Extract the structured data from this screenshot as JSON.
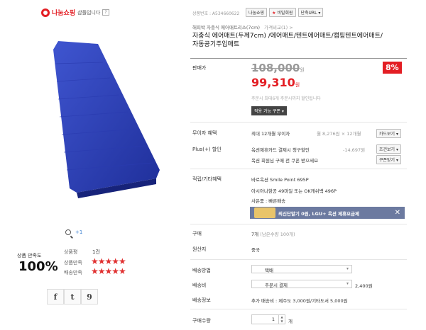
{
  "store": {
    "name": "나눔쇼핑",
    "suffix": "샵플입니다",
    "help_glyph": "?"
  },
  "header": {
    "product_no": "상품번호 : A534660622",
    "seller_badge": "나눔쇼핑",
    "mini_shop": "비밀회원",
    "shortcut": "단축URL"
  },
  "title": {
    "category": "해피박 자충식 에어매트리스(7cm)",
    "compare": "가격비교(1) >",
    "line1": "자충식 에어매트(두께7cm) /에어매트/텐트에어매트/캠핑텐트에어매트/",
    "line2": "자동공기주입매트"
  },
  "price": {
    "label": "판매가",
    "original": "108,000",
    "original_unit": "원",
    "discount_badge": "8%",
    "sale": "99,310",
    "sale_unit": "원",
    "note": "주문시 최대6개 주문시까지 할인됩니다",
    "coupon_button": "적용 가능 쿠폰"
  },
  "benefits": {
    "installment_label": "무이자 혜택",
    "installment_text": "최대 12개월 무이자",
    "installment_detail": "월 8,276원 × 12개월",
    "installment_btn": "카드보기",
    "plus_label": "Plus(+) 할인",
    "plus_text": "옥션제휴카드 결제시 청구할인",
    "plus_amount": "-14,697원",
    "plus_btn": "조건보기",
    "coupon_text": "옥션 회원님 구매 전 쿠폰 받으세요",
    "coupon_btn": "쿠폰받기"
  },
  "points": {
    "label": "적립/기타혜택",
    "line1": "바로옥션 Smile Point 695P",
    "line2": "아시아나항공 49마일 또는 OK캐쉬백 496P",
    "line3": "사은품 : 빠른배송",
    "banner": "최신단말기 0원, LGU+ 옥션 제휴요금제"
  },
  "purchase": {
    "qty_label": "구매",
    "qty_text": "7개",
    "qty_remain": "(남은수량 100개)",
    "origin_label": "원산지",
    "origin": "중국",
    "ship_method_label": "배송방법",
    "ship_method": "택배",
    "ship_fee_label": "배송비",
    "ship_fee_option": "주문시 결제",
    "ship_fee": "2,400원",
    "ship_info_label": "배송정보",
    "ship_info": "추가 배송비 : 제주도 3,000원/기타도서 5,000원",
    "buy_qty_label": "구매수량",
    "buy_qty_value": "1",
    "buy_qty_unit": "개"
  },
  "gallery": {
    "zoom_count": "+1"
  },
  "satisfaction": {
    "title": "상품 만족도",
    "percent": "100%",
    "review_label": "상품평",
    "review_count": "1건",
    "product_label": "상품만족",
    "delivery_label": "배송만족",
    "stars": "★★★★★"
  },
  "share": {
    "facebook": "f",
    "twitter": "t",
    "other": "9"
  },
  "colors": {
    "accent_red": "#e31e24",
    "mat_blue": "#2b3fb8"
  }
}
